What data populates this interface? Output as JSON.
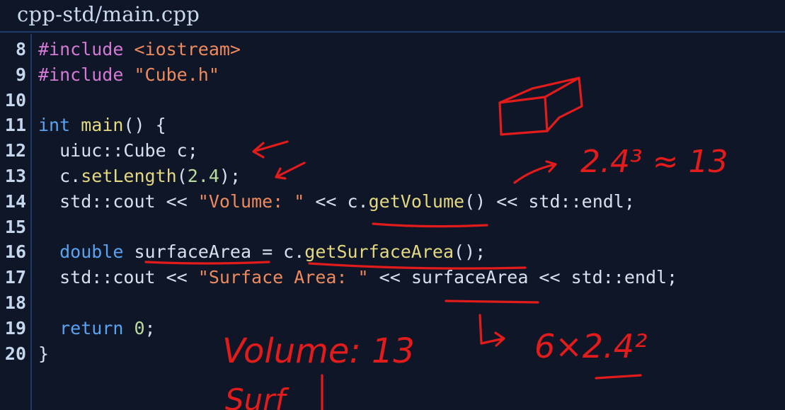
{
  "title": "cpp-std/main.cpp",
  "lines": [
    {
      "no": "8",
      "parts": [
        {
          "c": "pp",
          "t": "#include "
        },
        {
          "c": "str",
          "t": "<iostream>"
        }
      ]
    },
    {
      "no": "9",
      "parts": [
        {
          "c": "pp",
          "t": "#include "
        },
        {
          "c": "str",
          "t": "\"Cube.h\""
        }
      ]
    },
    {
      "no": "10",
      "parts": []
    },
    {
      "no": "11",
      "parts": [
        {
          "c": "kw",
          "t": "int "
        },
        {
          "c": "fn",
          "t": "main"
        },
        {
          "c": "plain",
          "t": "() {"
        }
      ]
    },
    {
      "no": "12",
      "parts": [
        {
          "c": "plain",
          "t": "  uiuc::Cube c;"
        }
      ]
    },
    {
      "no": "13",
      "parts": [
        {
          "c": "plain",
          "t": "  c."
        },
        {
          "c": "fn",
          "t": "setLength"
        },
        {
          "c": "plain",
          "t": "("
        },
        {
          "c": "num",
          "t": "2.4"
        },
        {
          "c": "plain",
          "t": ");"
        }
      ]
    },
    {
      "no": "14",
      "parts": [
        {
          "c": "plain",
          "t": "  std::cout << "
        },
        {
          "c": "str",
          "t": "\"Volume: \""
        },
        {
          "c": "plain",
          "t": " << c."
        },
        {
          "c": "fn",
          "t": "getVolume"
        },
        {
          "c": "plain",
          "t": "() << std::endl;"
        }
      ]
    },
    {
      "no": "15",
      "parts": []
    },
    {
      "no": "16",
      "parts": [
        {
          "c": "plain",
          "t": "  "
        },
        {
          "c": "kw",
          "t": "double "
        },
        {
          "c": "plain",
          "t": "surfaceArea = c."
        },
        {
          "c": "fn",
          "t": "getSurfaceArea"
        },
        {
          "c": "plain",
          "t": "();"
        }
      ]
    },
    {
      "no": "17",
      "parts": [
        {
          "c": "plain",
          "t": "  std::cout << "
        },
        {
          "c": "str",
          "t": "\"Surface Area: \""
        },
        {
          "c": "plain",
          "t": " << surfaceArea << std::endl;"
        }
      ]
    },
    {
      "no": "18",
      "parts": []
    },
    {
      "no": "19",
      "parts": [
        {
          "c": "plain",
          "t": "  "
        },
        {
          "c": "kw",
          "t": "return "
        },
        {
          "c": "num",
          "t": "0"
        },
        {
          "c": "plain",
          "t": ";"
        }
      ]
    },
    {
      "no": "20",
      "parts": [
        {
          "c": "plain",
          "t": "}"
        }
      ]
    }
  ],
  "annotations": {
    "volume_calc": "2.4³ ≈ 13",
    "surface_calc": "6×2.4²",
    "volume_result": "Volume: 13",
    "surface_partial": "Surf"
  },
  "colors": {
    "background": "#0e1628",
    "preprocessor": "#d47ad4",
    "string": "#ee8a5c",
    "keyword": "#5aa3f0",
    "function": "#e4d880",
    "number": "#b9dda0",
    "ink": "#e21b1b"
  }
}
